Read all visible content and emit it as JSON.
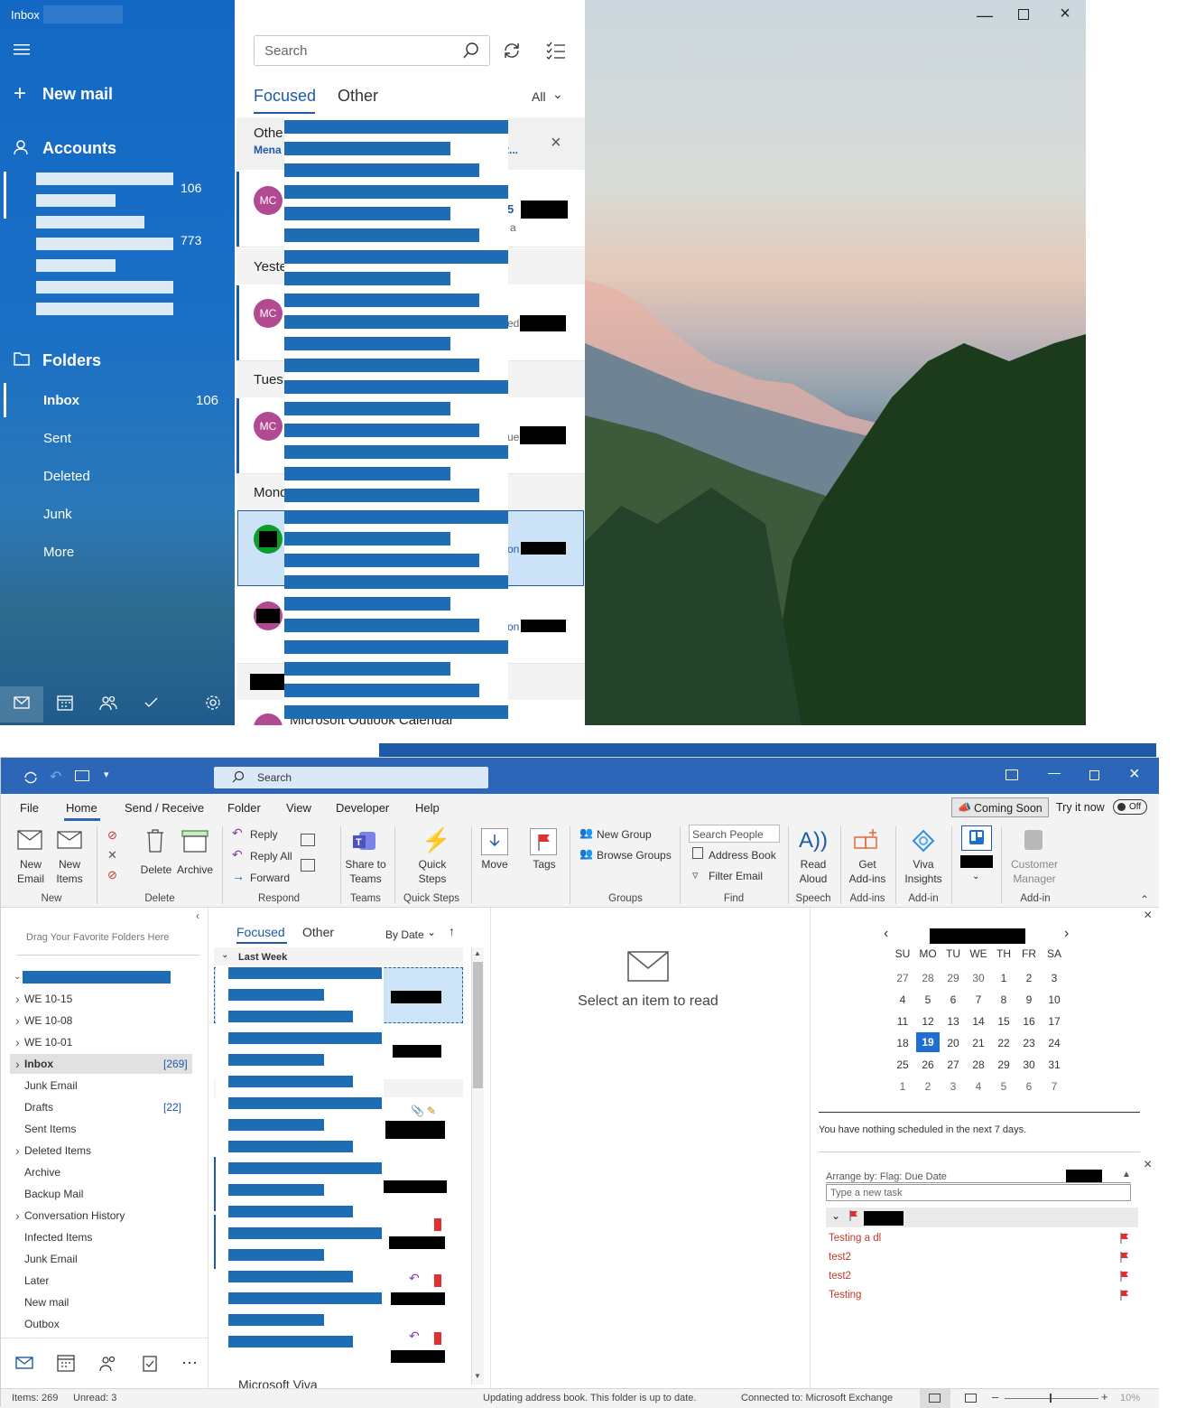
{
  "mail": {
    "window_title": "Inbox",
    "sidebar": {
      "new_mail": "New mail",
      "accounts": "Accounts",
      "account_counts": [
        "106",
        "773"
      ],
      "folders_heading": "Folders",
      "folders": [
        {
          "label": "Inbox",
          "count": "106"
        },
        {
          "label": "Sent",
          "count": ""
        },
        {
          "label": "Deleted",
          "count": ""
        },
        {
          "label": "Junk",
          "count": ""
        },
        {
          "label": "More",
          "count": ""
        }
      ]
    },
    "search_placeholder": "Search",
    "tabs": {
      "focused": "Focused",
      "other": "Other",
      "filter": "All"
    },
    "banner": {
      "title": "Othe",
      "subtitle": "Mena",
      "suffix": "t..."
    },
    "date_headers": [
      "Yeste",
      "Tues",
      "Mond"
    ],
    "avatar_initials": "MC",
    "row_fragments": [
      "5",
      "a",
      "ed",
      "ue",
      "on",
      "on"
    ],
    "last_item_sender": "Microsoft Outlook Calendar"
  },
  "outlook": {
    "search_placeholder": "Search",
    "menu_tabs": [
      "File",
      "Home",
      "Send / Receive",
      "Folder",
      "View",
      "Developer",
      "Help"
    ],
    "coming_soon": "Coming Soon",
    "try_it_now": "Try it now",
    "toggle_state": "Off",
    "ribbon": {
      "new_email": [
        "New",
        "Email"
      ],
      "new_items": [
        "New",
        "Items"
      ],
      "delete": "Delete",
      "archive": "Archive",
      "reply": "Reply",
      "reply_all": "Reply All",
      "forward": "Forward",
      "share_teams": [
        "Share to",
        "Teams"
      ],
      "quick_steps": [
        "Quick",
        "Steps"
      ],
      "move": "Move",
      "tags": "Tags",
      "new_group": "New Group",
      "browse_groups": "Browse Groups",
      "search_people": "Search People",
      "address_book": "Address Book",
      "filter_email": "Filter Email",
      "read_aloud": [
        "Read",
        "Aloud"
      ],
      "get_addins": [
        "Get",
        "Add-ins"
      ],
      "viva_insights": [
        "Viva",
        "Insights"
      ],
      "customer_manager": [
        "Customer",
        "Manager"
      ],
      "groups": [
        "New",
        "Delete",
        "Respond",
        "Teams",
        "Quick Steps",
        "Groups",
        "Find",
        "Speech",
        "Add-ins",
        "Add-in",
        "Add-in"
      ]
    },
    "nav": {
      "favorites_hint": "Drag Your Favorite Folders Here",
      "folders": [
        {
          "label": "WE 10-15",
          "count": "",
          "chevron": true
        },
        {
          "label": "WE 10-08",
          "count": "",
          "chevron": true
        },
        {
          "label": "WE 10-01",
          "count": "",
          "chevron": true
        },
        {
          "label": "Inbox",
          "count": "[269]",
          "chevron": true
        },
        {
          "label": "Junk Email",
          "count": "",
          "chevron": false
        },
        {
          "label": "Drafts",
          "count": "[22]",
          "chevron": false
        },
        {
          "label": "Sent Items",
          "count": "",
          "chevron": false
        },
        {
          "label": "Deleted Items",
          "count": "",
          "chevron": true
        },
        {
          "label": "Archive",
          "count": "",
          "chevron": false
        },
        {
          "label": "Backup Mail",
          "count": "",
          "chevron": false
        },
        {
          "label": "Conversation History",
          "count": "",
          "chevron": true
        },
        {
          "label": "Infected Items",
          "count": "",
          "chevron": false
        },
        {
          "label": "Junk Email",
          "count": "",
          "chevron": false
        },
        {
          "label": "Later",
          "count": "",
          "chevron": false
        },
        {
          "label": "New mail",
          "count": "",
          "chevron": false
        },
        {
          "label": "Outbox",
          "count": "",
          "chevron": false
        }
      ]
    },
    "list": {
      "focused": "Focused",
      "other": "Other",
      "sort": "By Date",
      "group_header": "Last Week",
      "last_sender": "Microsoft Viva"
    },
    "reading": {
      "empty": "Select an item to read"
    },
    "calendar": {
      "weekdays": [
        "SU",
        "MO",
        "TU",
        "WE",
        "TH",
        "FR",
        "SA"
      ],
      "weeks": [
        [
          "27",
          "28",
          "29",
          "30",
          "1",
          "2",
          "3"
        ],
        [
          "4",
          "5",
          "6",
          "7",
          "8",
          "9",
          "10"
        ],
        [
          "11",
          "12",
          "13",
          "14",
          "15",
          "16",
          "17"
        ],
        [
          "18",
          "19",
          "20",
          "21",
          "22",
          "23",
          "24"
        ],
        [
          "25",
          "26",
          "27",
          "28",
          "29",
          "30",
          "31"
        ],
        [
          "1",
          "2",
          "3",
          "4",
          "5",
          "6",
          "7"
        ]
      ],
      "today": "19",
      "agenda": "You have nothing scheduled in the next 7 days."
    },
    "tasks": {
      "arrange": "Arrange by: Flag: Due Date",
      "new_task_placeholder": "Type a new task",
      "items": [
        "Testing a dl",
        "test2",
        "test2",
        "Testing"
      ],
      "flag_color": "#e03030"
    },
    "status": {
      "items": "Items: 269",
      "unread": "Unread: 3",
      "message": "Updating address book.  This folder is up to date.",
      "connection": "Connected to: Microsoft Exchange",
      "zoom": "10%"
    },
    "accent": "#2b66b8"
  }
}
